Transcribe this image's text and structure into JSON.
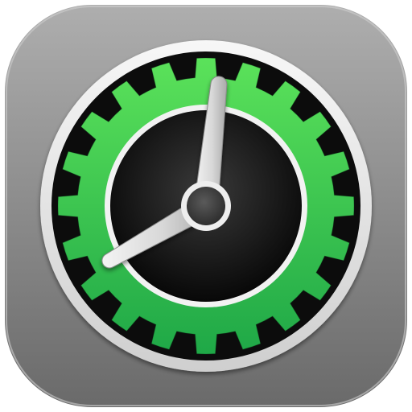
{
  "icon": {
    "name": "clock-gear-app-icon",
    "tile": {
      "gradient_top": "#aeaeae",
      "gradient_mid": "#8c8c8c",
      "gradient_bottom": "#6a6a6a",
      "highlight": "#cfcfcf"
    },
    "bezel": {
      "outer_ring_color": "#e9e9e9",
      "outer_ring_shadow": "#bdbdbd",
      "black_ring_color": "#0c0c0c"
    },
    "gear": {
      "teeth": 20,
      "color_top": "#5be25a",
      "color_bottom": "#1fa847"
    },
    "face": {
      "rim_color": "#f2f2f2",
      "color_center": "#3a3a3a",
      "color_edge": "#060606"
    },
    "hands": {
      "color_light": "#f4f4f4",
      "color_dark": "#a9a9a9",
      "hub_color": "#4a4a4a",
      "hub_rim_color": "#eeeeee"
    },
    "time_shown": {
      "hour": 8,
      "minute": 1
    }
  }
}
